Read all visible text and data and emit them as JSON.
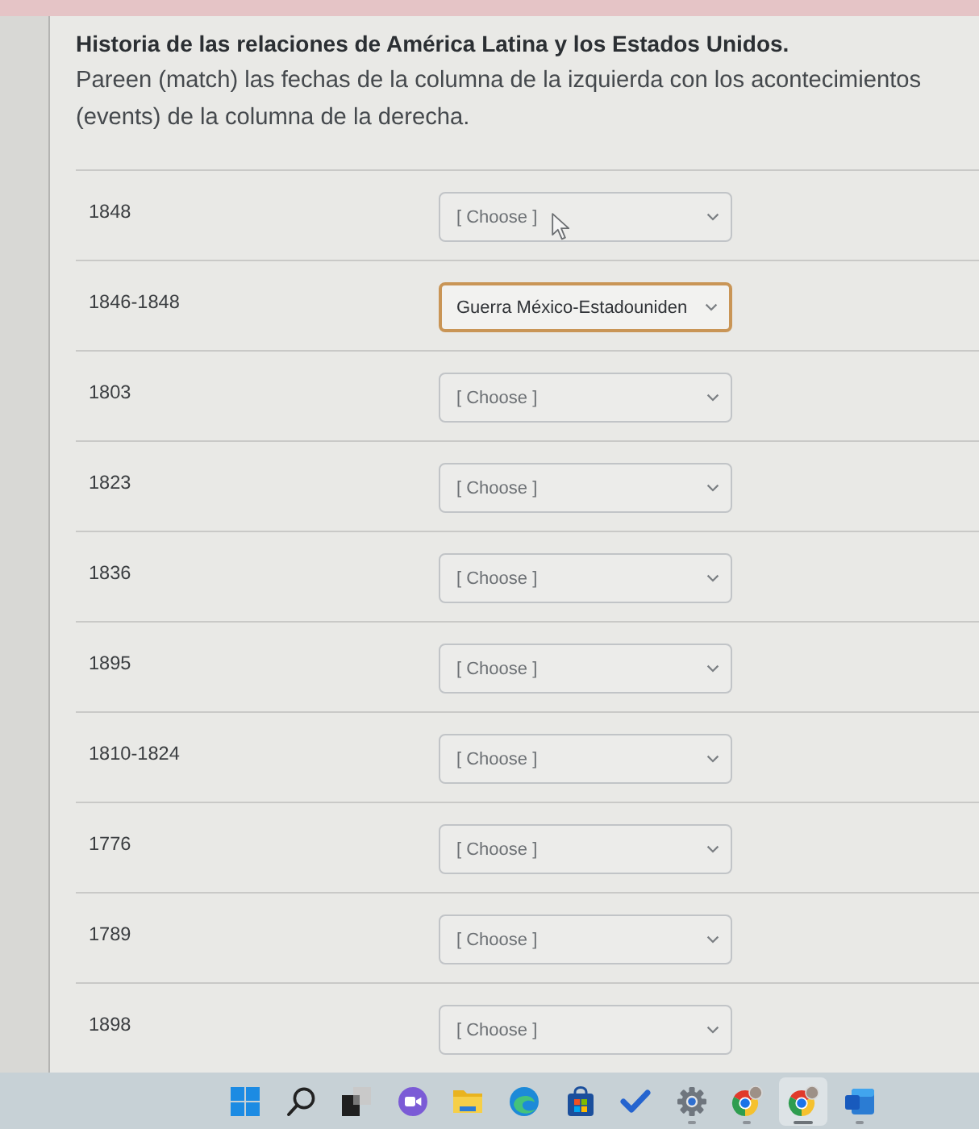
{
  "header": {
    "title": "Historia de las relaciones de América Latina y los Estados Unidos.",
    "instructions": "Pareen (match) las fechas de la columna de la izquierda con los acontecimientos (events) de la columna de la derecha."
  },
  "rows": [
    {
      "date": "1848",
      "answer": "[ Choose ]",
      "chosen": false,
      "focused": false,
      "hovered": true
    },
    {
      "date": "1846-1848",
      "answer": "Guerra México-Estadouniden",
      "chosen": true,
      "focused": true,
      "hovered": false
    },
    {
      "date": "1803",
      "answer": "[ Choose ]",
      "chosen": false,
      "focused": false,
      "hovered": false
    },
    {
      "date": "1823",
      "answer": "[ Choose ]",
      "chosen": false,
      "focused": false,
      "hovered": false
    },
    {
      "date": "1836",
      "answer": "[ Choose ]",
      "chosen": false,
      "focused": false,
      "hovered": false
    },
    {
      "date": "1895",
      "answer": "[ Choose ]",
      "chosen": false,
      "focused": false,
      "hovered": false
    },
    {
      "date": "1810-1824",
      "answer": "[ Choose ]",
      "chosen": false,
      "focused": false,
      "hovered": false
    },
    {
      "date": "1776",
      "answer": "[ Choose ]",
      "chosen": false,
      "focused": false,
      "hovered": false
    },
    {
      "date": "1789",
      "answer": "[ Choose ]",
      "chosen": false,
      "focused": false,
      "hovered": false
    },
    {
      "date": "1898",
      "answer": "[ Choose ]",
      "chosen": false,
      "focused": false,
      "hovered": false
    }
  ],
  "taskbar": {
    "items": [
      {
        "kind": "start",
        "running": false,
        "selected": false
      },
      {
        "kind": "search",
        "running": false,
        "selected": false
      },
      {
        "kind": "task_view",
        "running": false,
        "selected": false
      },
      {
        "kind": "chat",
        "running": false,
        "selected": false
      },
      {
        "kind": "files",
        "running": false,
        "selected": false
      },
      {
        "kind": "edge",
        "running": false,
        "selected": false
      },
      {
        "kind": "store",
        "running": false,
        "selected": false
      },
      {
        "kind": "todo",
        "running": false,
        "selected": false
      },
      {
        "kind": "settings",
        "running": true,
        "selected": false
      },
      {
        "kind": "chrome",
        "running": true,
        "selected": false
      },
      {
        "kind": "chrome",
        "running": true,
        "selected": true
      },
      {
        "kind": "word",
        "running": true,
        "selected": false
      }
    ]
  }
}
